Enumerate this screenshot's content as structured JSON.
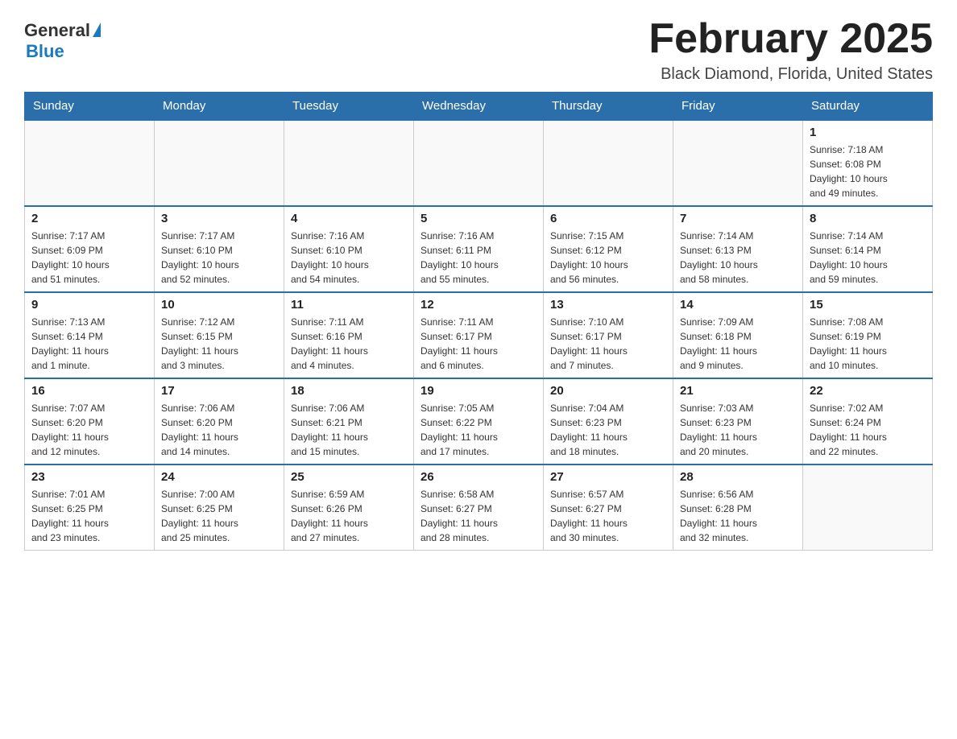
{
  "logo": {
    "general": "General",
    "blue": "Blue"
  },
  "title": "February 2025",
  "location": "Black Diamond, Florida, United States",
  "days_of_week": [
    "Sunday",
    "Monday",
    "Tuesday",
    "Wednesday",
    "Thursday",
    "Friday",
    "Saturday"
  ],
  "weeks": [
    [
      {
        "day": "",
        "info": ""
      },
      {
        "day": "",
        "info": ""
      },
      {
        "day": "",
        "info": ""
      },
      {
        "day": "",
        "info": ""
      },
      {
        "day": "",
        "info": ""
      },
      {
        "day": "",
        "info": ""
      },
      {
        "day": "1",
        "info": "Sunrise: 7:18 AM\nSunset: 6:08 PM\nDaylight: 10 hours\nand 49 minutes."
      }
    ],
    [
      {
        "day": "2",
        "info": "Sunrise: 7:17 AM\nSunset: 6:09 PM\nDaylight: 10 hours\nand 51 minutes."
      },
      {
        "day": "3",
        "info": "Sunrise: 7:17 AM\nSunset: 6:10 PM\nDaylight: 10 hours\nand 52 minutes."
      },
      {
        "day": "4",
        "info": "Sunrise: 7:16 AM\nSunset: 6:10 PM\nDaylight: 10 hours\nand 54 minutes."
      },
      {
        "day": "5",
        "info": "Sunrise: 7:16 AM\nSunset: 6:11 PM\nDaylight: 10 hours\nand 55 minutes."
      },
      {
        "day": "6",
        "info": "Sunrise: 7:15 AM\nSunset: 6:12 PM\nDaylight: 10 hours\nand 56 minutes."
      },
      {
        "day": "7",
        "info": "Sunrise: 7:14 AM\nSunset: 6:13 PM\nDaylight: 10 hours\nand 58 minutes."
      },
      {
        "day": "8",
        "info": "Sunrise: 7:14 AM\nSunset: 6:14 PM\nDaylight: 10 hours\nand 59 minutes."
      }
    ],
    [
      {
        "day": "9",
        "info": "Sunrise: 7:13 AM\nSunset: 6:14 PM\nDaylight: 11 hours\nand 1 minute."
      },
      {
        "day": "10",
        "info": "Sunrise: 7:12 AM\nSunset: 6:15 PM\nDaylight: 11 hours\nand 3 minutes."
      },
      {
        "day": "11",
        "info": "Sunrise: 7:11 AM\nSunset: 6:16 PM\nDaylight: 11 hours\nand 4 minutes."
      },
      {
        "day": "12",
        "info": "Sunrise: 7:11 AM\nSunset: 6:17 PM\nDaylight: 11 hours\nand 6 minutes."
      },
      {
        "day": "13",
        "info": "Sunrise: 7:10 AM\nSunset: 6:17 PM\nDaylight: 11 hours\nand 7 minutes."
      },
      {
        "day": "14",
        "info": "Sunrise: 7:09 AM\nSunset: 6:18 PM\nDaylight: 11 hours\nand 9 minutes."
      },
      {
        "day": "15",
        "info": "Sunrise: 7:08 AM\nSunset: 6:19 PM\nDaylight: 11 hours\nand 10 minutes."
      }
    ],
    [
      {
        "day": "16",
        "info": "Sunrise: 7:07 AM\nSunset: 6:20 PM\nDaylight: 11 hours\nand 12 minutes."
      },
      {
        "day": "17",
        "info": "Sunrise: 7:06 AM\nSunset: 6:20 PM\nDaylight: 11 hours\nand 14 minutes."
      },
      {
        "day": "18",
        "info": "Sunrise: 7:06 AM\nSunset: 6:21 PM\nDaylight: 11 hours\nand 15 minutes."
      },
      {
        "day": "19",
        "info": "Sunrise: 7:05 AM\nSunset: 6:22 PM\nDaylight: 11 hours\nand 17 minutes."
      },
      {
        "day": "20",
        "info": "Sunrise: 7:04 AM\nSunset: 6:23 PM\nDaylight: 11 hours\nand 18 minutes."
      },
      {
        "day": "21",
        "info": "Sunrise: 7:03 AM\nSunset: 6:23 PM\nDaylight: 11 hours\nand 20 minutes."
      },
      {
        "day": "22",
        "info": "Sunrise: 7:02 AM\nSunset: 6:24 PM\nDaylight: 11 hours\nand 22 minutes."
      }
    ],
    [
      {
        "day": "23",
        "info": "Sunrise: 7:01 AM\nSunset: 6:25 PM\nDaylight: 11 hours\nand 23 minutes."
      },
      {
        "day": "24",
        "info": "Sunrise: 7:00 AM\nSunset: 6:25 PM\nDaylight: 11 hours\nand 25 minutes."
      },
      {
        "day": "25",
        "info": "Sunrise: 6:59 AM\nSunset: 6:26 PM\nDaylight: 11 hours\nand 27 minutes."
      },
      {
        "day": "26",
        "info": "Sunrise: 6:58 AM\nSunset: 6:27 PM\nDaylight: 11 hours\nand 28 minutes."
      },
      {
        "day": "27",
        "info": "Sunrise: 6:57 AM\nSunset: 6:27 PM\nDaylight: 11 hours\nand 30 minutes."
      },
      {
        "day": "28",
        "info": "Sunrise: 6:56 AM\nSunset: 6:28 PM\nDaylight: 11 hours\nand 32 minutes."
      },
      {
        "day": "",
        "info": ""
      }
    ]
  ]
}
